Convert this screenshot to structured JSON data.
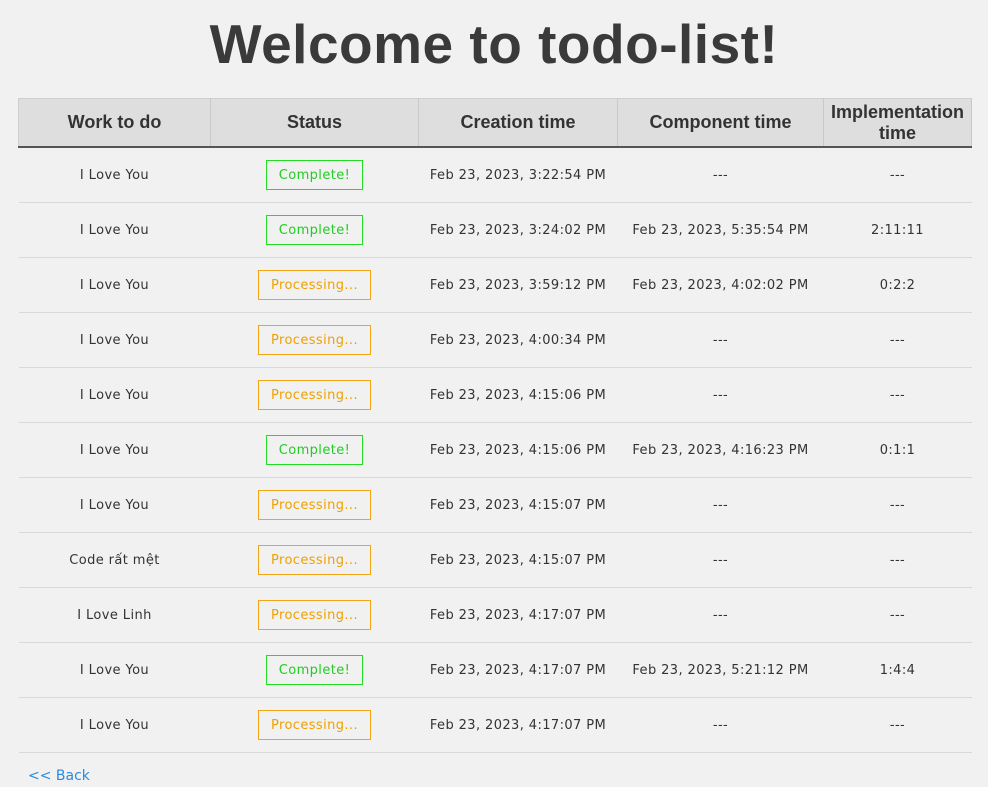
{
  "page": {
    "title": "Welcome to todo-list!",
    "back_link": "<< Back"
  },
  "colors": {
    "complete": "#22cc22",
    "processing": "#f0a000",
    "link": "#2a8be0"
  },
  "table": {
    "headers": [
      "Work to do",
      "Status",
      "Creation time",
      "Component time",
      "Implementation time"
    ],
    "rows": [
      {
        "work": "I Love You",
        "status": "Complete!",
        "status_type": "complete",
        "creation": "Feb 23, 2023, 3:22:54 PM",
        "component": "---",
        "implementation": "---"
      },
      {
        "work": "I Love You",
        "status": "Complete!",
        "status_type": "complete",
        "creation": "Feb 23, 2023, 3:24:02 PM",
        "component": "Feb 23, 2023, 5:35:54 PM",
        "implementation": "2:11:11"
      },
      {
        "work": "I Love You",
        "status": "Processing...",
        "status_type": "processing",
        "creation": "Feb 23, 2023, 3:59:12 PM",
        "component": "Feb 23, 2023, 4:02:02 PM",
        "implementation": "0:2:2"
      },
      {
        "work": "I Love You",
        "status": "Processing...",
        "status_type": "processing",
        "creation": "Feb 23, 2023, 4:00:34 PM",
        "component": "---",
        "implementation": "---"
      },
      {
        "work": "I Love You",
        "status": "Processing...",
        "status_type": "processing",
        "creation": "Feb 23, 2023, 4:15:06 PM",
        "component": "---",
        "implementation": "---"
      },
      {
        "work": "I Love You",
        "status": "Complete!",
        "status_type": "complete",
        "creation": "Feb 23, 2023, 4:15:06 PM",
        "component": "Feb 23, 2023, 4:16:23 PM",
        "implementation": "0:1:1"
      },
      {
        "work": "I Love You",
        "status": "Processing...",
        "status_type": "processing",
        "creation": "Feb 23, 2023, 4:15:07 PM",
        "component": "---",
        "implementation": "---"
      },
      {
        "work": "Code rất mệt",
        "status": "Processing...",
        "status_type": "processing",
        "creation": "Feb 23, 2023, 4:15:07 PM",
        "component": "---",
        "implementation": "---"
      },
      {
        "work": "I Love Linh",
        "status": "Processing...",
        "status_type": "processing",
        "creation": "Feb 23, 2023, 4:17:07 PM",
        "component": "---",
        "implementation": "---"
      },
      {
        "work": "I Love You",
        "status": "Complete!",
        "status_type": "complete",
        "creation": "Feb 23, 2023, 4:17:07 PM",
        "component": "Feb 23, 2023, 5:21:12 PM",
        "implementation": "1:4:4"
      },
      {
        "work": "I Love You",
        "status": "Processing...",
        "status_type": "processing",
        "creation": "Feb 23, 2023, 4:17:07 PM",
        "component": "---",
        "implementation": "---"
      }
    ]
  }
}
